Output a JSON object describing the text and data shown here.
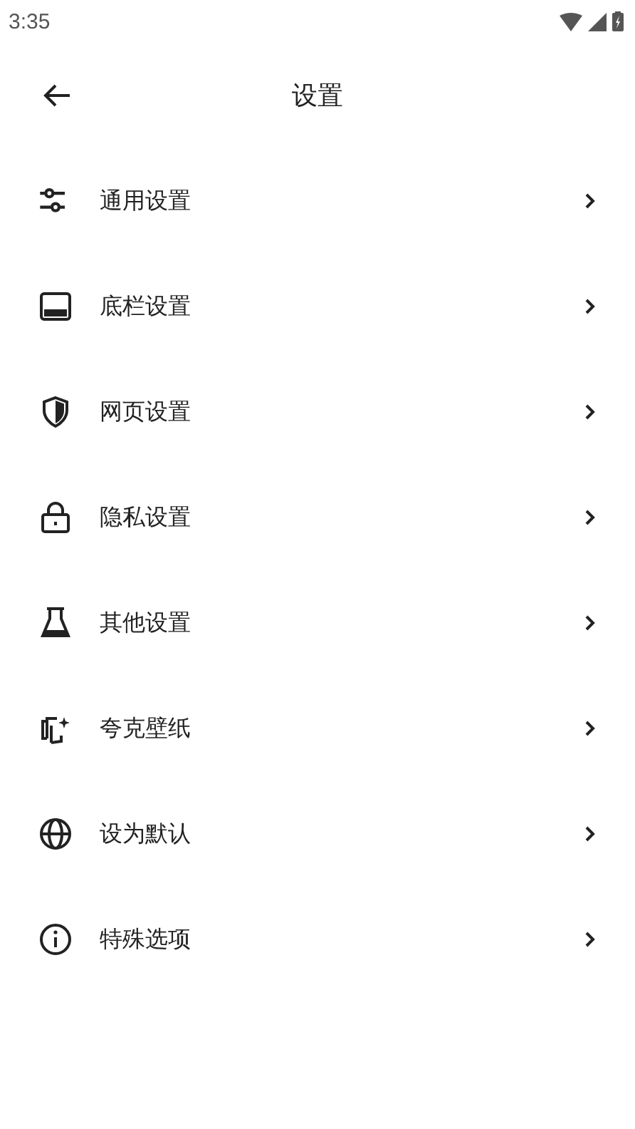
{
  "status_bar": {
    "time": "3:35"
  },
  "header": {
    "title": "设置"
  },
  "items": [
    {
      "label": "通用设置"
    },
    {
      "label": "底栏设置"
    },
    {
      "label": "网页设置"
    },
    {
      "label": "隐私设置"
    },
    {
      "label": "其他设置"
    },
    {
      "label": "夸克壁纸"
    },
    {
      "label": "设为默认"
    },
    {
      "label": "特殊选项"
    }
  ]
}
